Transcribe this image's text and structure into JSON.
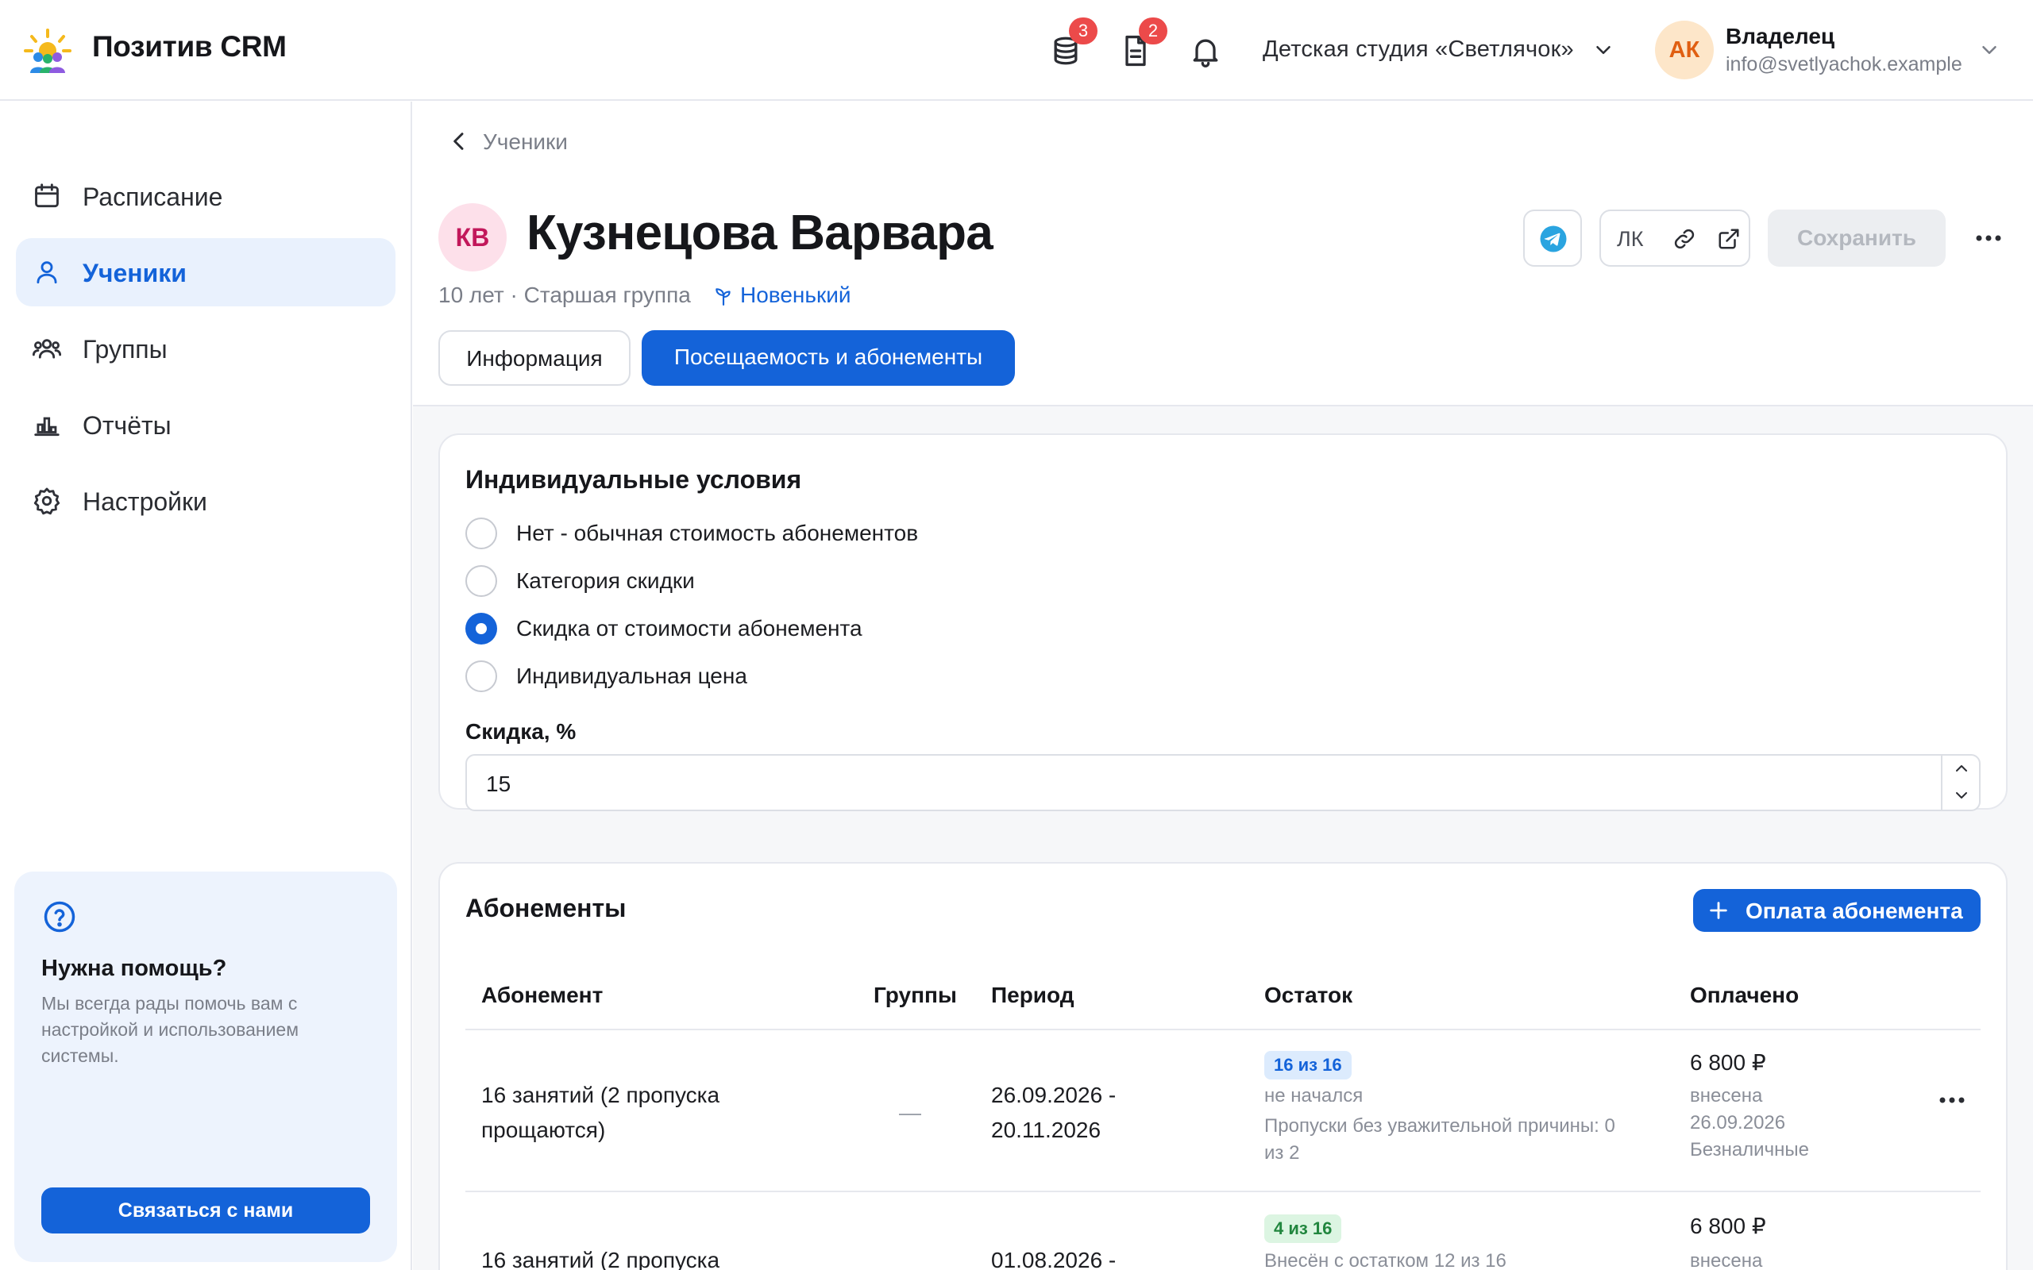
{
  "app": {
    "title": "Позитив CRM"
  },
  "header": {
    "badges": {
      "payments": "3",
      "documents": "2"
    },
    "studio": "Детская студия «Светлячок»",
    "user": {
      "initials": "АК",
      "name": "Владелец",
      "email": "info@svetlyachok.example"
    }
  },
  "sidebar": {
    "items": [
      {
        "label": "Расписание",
        "icon": "calendar-icon",
        "active": false
      },
      {
        "label": "Ученики",
        "icon": "user-icon",
        "active": true
      },
      {
        "label": "Группы",
        "icon": "users-icon",
        "active": false
      },
      {
        "label": "Отчёты",
        "icon": "bar-chart-icon",
        "active": false
      },
      {
        "label": "Настройки",
        "icon": "gear-icon",
        "active": false
      }
    ],
    "help": {
      "title": "Нужна помощь?",
      "text": "Мы всегда рады помочь вам с настройкой и использованием системы.",
      "button": "Связаться с нами"
    }
  },
  "main": {
    "breadcrumb": "Ученики",
    "student": {
      "initials": "КВ",
      "name": "Кузнецова Варвара",
      "meta": "10 лет · Старшая группа",
      "tag": "Новенький"
    },
    "tabs": [
      {
        "label": "Информация",
        "active": false
      },
      {
        "label": "Посещаемость и абонементы",
        "active": true
      }
    ],
    "actions": {
      "lk_label": "ЛК",
      "save": "Сохранить"
    },
    "conditions": {
      "title": "Индивидуальные условия",
      "options": [
        "Нет - обычная стоимость абонементов",
        "Категория скидки",
        "Скидка от стоимости абонемента",
        "Индивидуальная цена"
      ],
      "selected_index": 2,
      "discount_label": "Скидка, %",
      "discount_value": "15"
    },
    "subscriptions": {
      "title": "Абонементы",
      "add_button": "Оплата абонемента",
      "columns": [
        "Абонемент",
        "Группы",
        "Период",
        "Остаток",
        "Оплачено"
      ],
      "rows": [
        {
          "name_line1": "16 занятий (2 пропуска",
          "name_line2": "прощаются)",
          "groups": "—",
          "period_line1": "26.09.2026 -",
          "period_line2": "20.11.2026",
          "remaining_badge": "16 из 16",
          "remaining_status": "не начался",
          "remaining_note_line1": "Пропуски без уважительной причины: 0",
          "remaining_note_line2": "из 2",
          "paid_amount": "6 800 ₽",
          "paid_status": "внесена",
          "paid_date": "26.09.2026",
          "paid_method": "Безналичные"
        },
        {
          "name_line1": "16 занятий (2 пропуска",
          "period_line1": "01.08.2026 -",
          "remaining_badge": "4 из 16",
          "remaining_status": "Внесён с остатком 12 из 16",
          "paid_amount": "6 800 ₽",
          "paid_status": "внесена"
        }
      ]
    }
  },
  "colors": {
    "accent": "#1463d9",
    "badge_red": "#ec4a4a",
    "muted": "#7a7e88"
  }
}
